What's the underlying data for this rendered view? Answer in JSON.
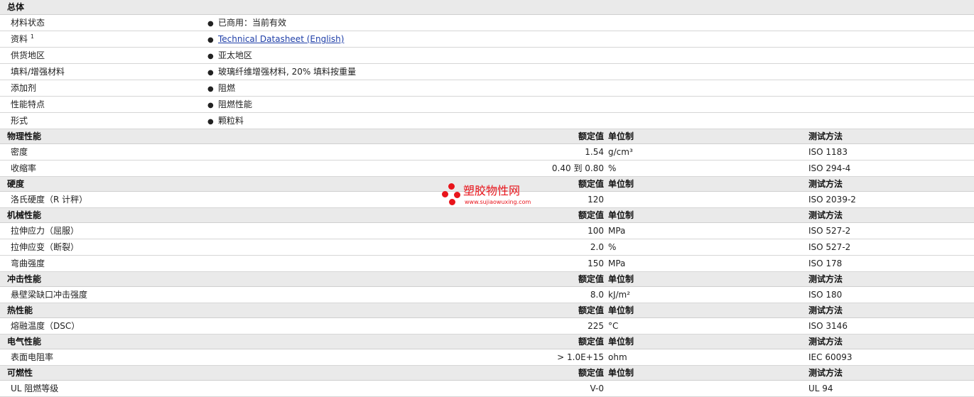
{
  "general": {
    "title": "总体",
    "rows": [
      {
        "label": "材料状态",
        "value": "已商用：当前有效",
        "link": false
      },
      {
        "label": "资料",
        "sup": "1",
        "value": "Technical Datasheet (English)",
        "link": true
      },
      {
        "label": "供货地区",
        "value": "亚太地区",
        "link": false
      },
      {
        "label": "填料/增强材料",
        "value": "玻璃纤维增强材料, 20% 填料按重量",
        "link": false
      },
      {
        "label": "添加剂",
        "value": "阻燃",
        "link": false
      },
      {
        "label": "性能特点",
        "value": "阻燃性能",
        "link": false
      },
      {
        "label": "形式",
        "value": "颗粒料",
        "link": false
      }
    ]
  },
  "column_headers": {
    "value": "额定值",
    "unit": "单位制",
    "test": "测试方法"
  },
  "sections": [
    {
      "title": "物理性能",
      "rows": [
        {
          "label": "密度",
          "value": "1.54",
          "unit": "g/cm³",
          "test": "ISO 1183"
        },
        {
          "label": "收缩率",
          "value": "0.40 到  0.80",
          "unit": "%",
          "test": "ISO 294-4"
        }
      ]
    },
    {
      "title": "硬度",
      "rows": [
        {
          "label": "洛氏硬度（R 计秤）",
          "value": "120",
          "unit": "",
          "test": "ISO 2039-2"
        }
      ]
    },
    {
      "title": "机械性能",
      "rows": [
        {
          "label": "拉伸应力（屈服）",
          "value": "100",
          "unit": "MPa",
          "test": "ISO 527-2"
        },
        {
          "label": "拉伸应变（断裂）",
          "value": "2.0",
          "unit": "%",
          "test": "ISO 527-2"
        },
        {
          "label": "弯曲强度",
          "value": "150",
          "unit": "MPa",
          "test": "ISO 178"
        }
      ]
    },
    {
      "title": "冲击性能",
      "rows": [
        {
          "label": "悬壁梁缺口冲击强度",
          "value": "8.0",
          "unit": "kJ/m²",
          "test": "ISO 180"
        }
      ]
    },
    {
      "title": "热性能",
      "rows": [
        {
          "label": "熔融温度（DSC）",
          "value": "225",
          "unit": "°C",
          "test": "ISO 3146"
        }
      ]
    },
    {
      "title": "电气性能",
      "rows": [
        {
          "label": "表面电阻率",
          "value": "> 1.0E+15",
          "unit": "ohm",
          "test": "IEC 60093"
        }
      ]
    },
    {
      "title": "可燃性",
      "rows": [
        {
          "label": "UL 阻燃等级",
          "value": "V-0",
          "unit": "",
          "test": "UL 94"
        }
      ]
    }
  ],
  "watermark": {
    "name": "塑胶物性网",
    "url": "www.sujiaowuxing.com",
    "color": "#e8141b"
  },
  "bullet_glyph": "●"
}
